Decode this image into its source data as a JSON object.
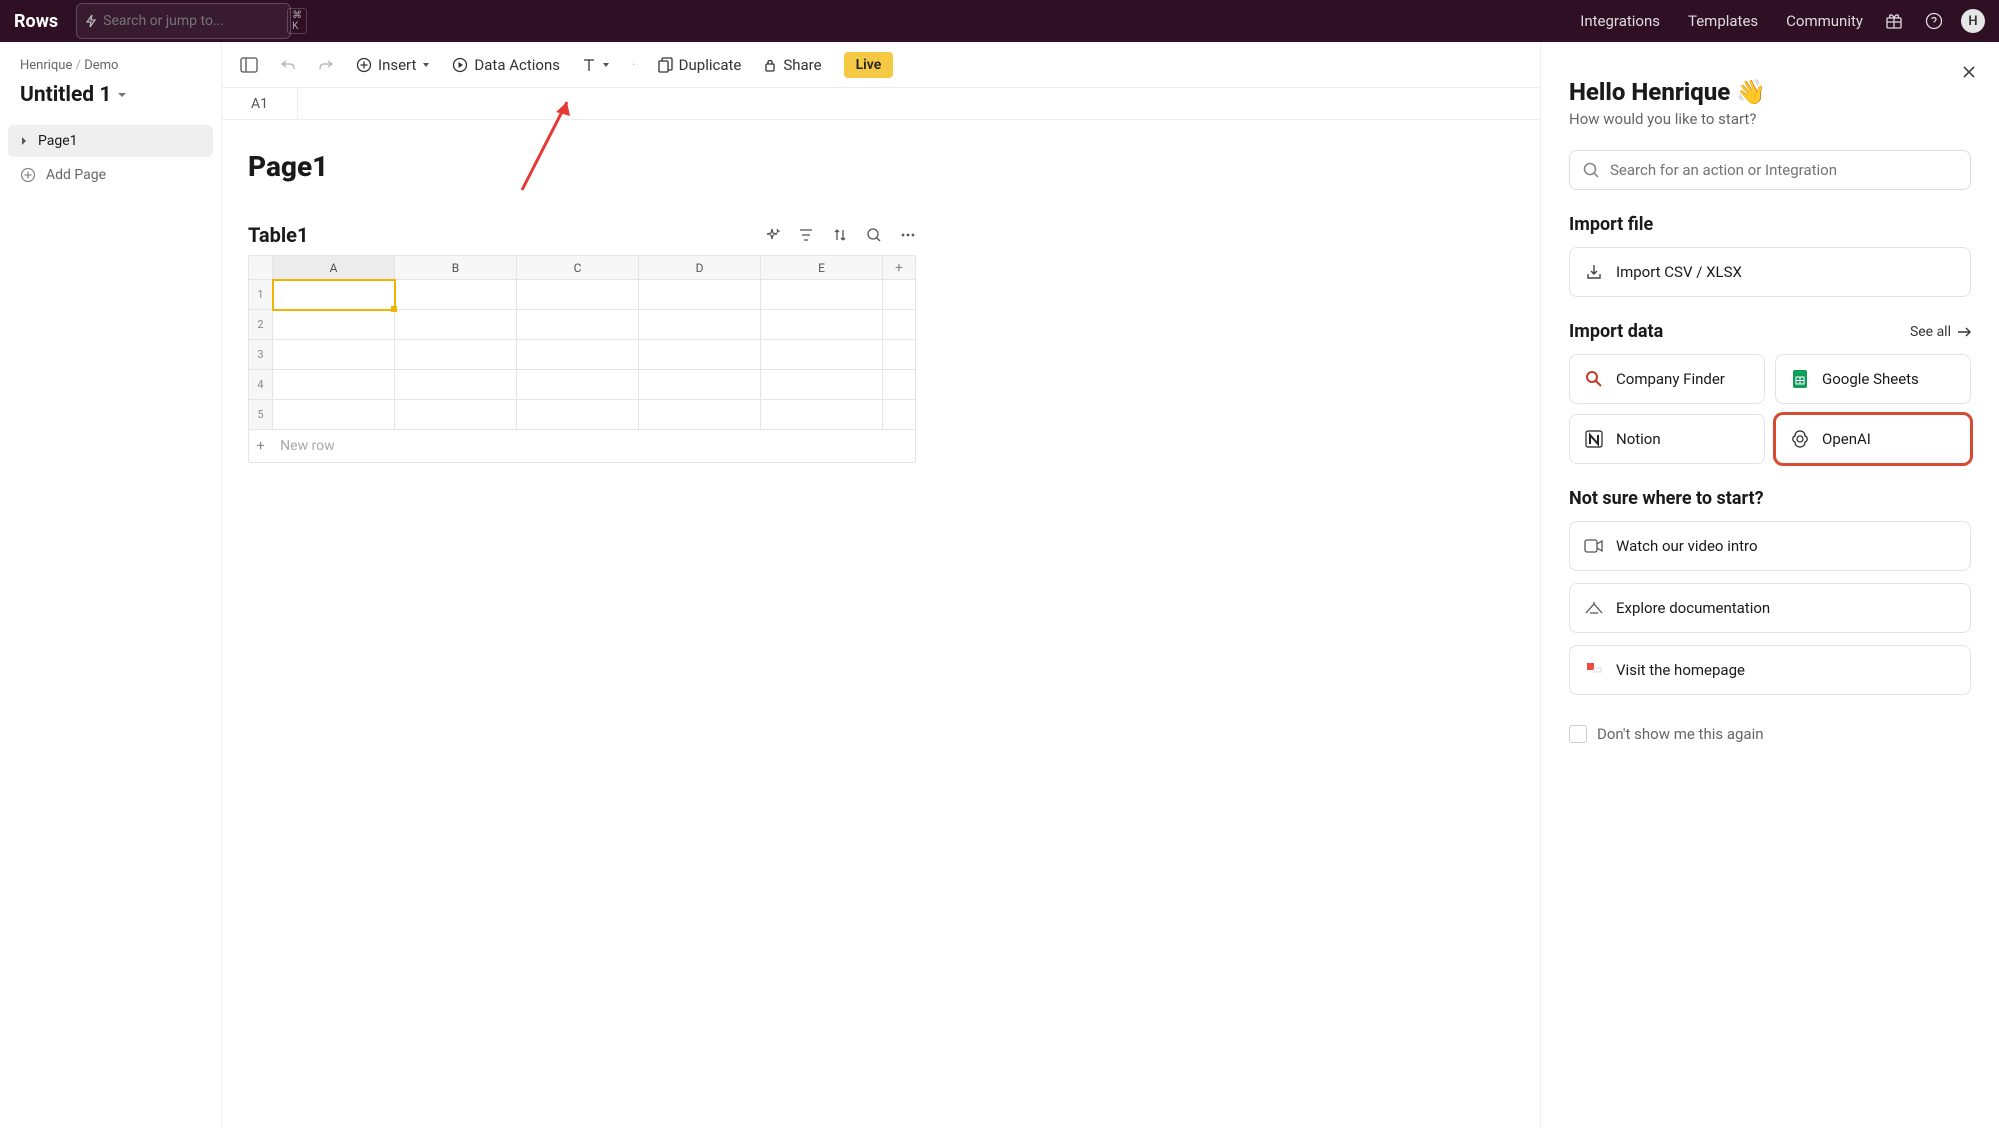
{
  "top": {
    "brand": "Rows",
    "search_placeholder": "Search or jump to...",
    "shortcut": "⌘ K",
    "links": [
      "Integrations",
      "Templates",
      "Community"
    ],
    "avatar_initial": "H"
  },
  "left": {
    "breadcrumb_owner": "Henrique",
    "breadcrumb_sep": "/",
    "breadcrumb_folder": "Demo",
    "doc_title": "Untitled 1",
    "pages": [
      "Page1"
    ],
    "add_page": "Add Page"
  },
  "toolbar": {
    "insert": "Insert",
    "data_actions": "Data Actions",
    "duplicate": "Duplicate",
    "share": "Share",
    "live": "Live"
  },
  "formula_bar": {
    "cell_ref": "A1"
  },
  "canvas": {
    "page_title": "Page1",
    "table_name": "Table1",
    "columns": [
      "A",
      "B",
      "C",
      "D",
      "E"
    ],
    "add_col": "+",
    "rows": [
      "1",
      "2",
      "3",
      "4",
      "5"
    ],
    "new_row": "New row",
    "selected_col_index": 0,
    "selected_row_index": 0
  },
  "right": {
    "hello": "Hello Henrique 👋",
    "how": "How would you like to start?",
    "search_placeholder": "Search for an action or Integration",
    "import_file_head": "Import file",
    "import_csv": "Import CSV / XLSX",
    "import_data_head": "Import data",
    "see_all": "See all",
    "integrations": [
      {
        "name": "Company Finder",
        "icon": "magnify"
      },
      {
        "name": "Google Sheets",
        "icon": "gsheet"
      },
      {
        "name": "Notion",
        "icon": "notion"
      },
      {
        "name": "OpenAI",
        "icon": "openai",
        "highlight": true
      }
    ],
    "not_sure_head": "Not sure where to start?",
    "help_items": [
      {
        "label": "Watch our video intro",
        "icon": "video"
      },
      {
        "label": "Explore documentation",
        "icon": "doc"
      },
      {
        "label": "Visit the homepage",
        "icon": "home"
      }
    ],
    "dont_show": "Don't show me this again"
  }
}
